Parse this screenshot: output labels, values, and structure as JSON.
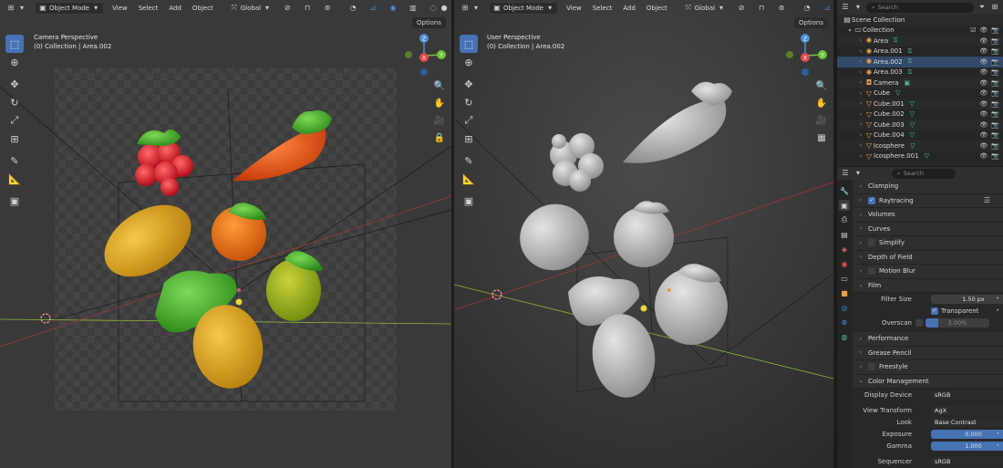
{
  "left_viewport": {
    "mode": "Object Mode",
    "menus": [
      "View",
      "Select",
      "Add",
      "Object"
    ],
    "transform": "Global",
    "options": "Options",
    "title": "Camera Perspective",
    "subtitle": "(0) Collection | Area.002"
  },
  "right_viewport": {
    "mode": "Object Mode",
    "menus": [
      "View",
      "Select",
      "Add",
      "Object"
    ],
    "transform": "Global",
    "options": "Options",
    "title": "User Perspective",
    "subtitle": "(0) Collection | Area.002"
  },
  "gizmo_axes": {
    "z": "Z",
    "y": "Y",
    "x": "X"
  },
  "colors": {
    "accent": "#4772b3",
    "x_axis": "#e0474f",
    "y_axis": "#6ec43f",
    "z_axis": "#4d8fd8",
    "orange_icon": "#e7a24b",
    "green_data": "#52c28f"
  },
  "outliner": {
    "search_placeholder": "Search",
    "scene_collection": "Scene Collection",
    "collection": "Collection",
    "items": [
      {
        "name": "Area",
        "type": "light"
      },
      {
        "name": "Area.001",
        "type": "light"
      },
      {
        "name": "Area.002",
        "type": "light"
      },
      {
        "name": "Area.003",
        "type": "light"
      },
      {
        "name": "Camera",
        "type": "camera"
      },
      {
        "name": "Cube",
        "type": "mesh"
      },
      {
        "name": "Cube.001",
        "type": "mesh"
      },
      {
        "name": "Cube.002",
        "type": "mesh"
      },
      {
        "name": "Cube.003",
        "type": "mesh"
      },
      {
        "name": "Cube.004",
        "type": "mesh"
      },
      {
        "name": "Icosphere",
        "type": "mesh"
      },
      {
        "name": "Icosphere.001",
        "type": "mesh"
      }
    ]
  },
  "properties": {
    "search_placeholder": "Search",
    "panels": {
      "clamping": "Clamping",
      "raytracing": "Raytracing",
      "volumes": "Volumes",
      "curves": "Curves",
      "simplify": "Simplify",
      "depth_of_field": "Depth of Field",
      "motion_blur": "Motion Blur",
      "film": "Film",
      "performance": "Performance",
      "grease_pencil": "Grease Pencil",
      "freestyle": "Freestyle",
      "color_management": "Color Management"
    },
    "film": {
      "filter_size_label": "Filter Size",
      "filter_size_value": "1.50 px",
      "transparent_label": "Transparent",
      "overscan_label": "Overscan",
      "overscan_value": "3.00%",
      "overscan_fraction": 0.2
    },
    "color_management": {
      "display_device_label": "Display Device",
      "display_device_value": "sRGB",
      "view_transform_label": "View Transform",
      "view_transform_value": "AgX",
      "look_label": "Look",
      "look_value": "Base Contrast",
      "exposure_label": "Exposure",
      "exposure_value": "0.000",
      "gamma_label": "Gamma",
      "gamma_value": "1.000",
      "sequencer_label": "Sequencer",
      "sequencer_value": "sRGB"
    }
  }
}
